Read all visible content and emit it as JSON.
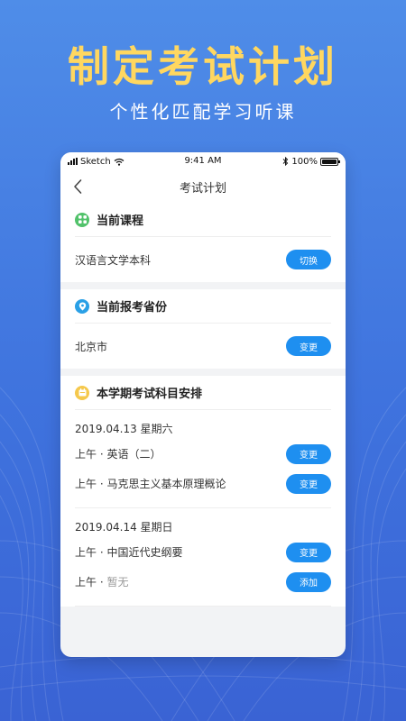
{
  "hero": {
    "title": "制定考试计划",
    "subtitle": "个性化匹配学习听课"
  },
  "status_bar": {
    "carrier": "Sketch",
    "time": "9:41 AM",
    "battery": "100%",
    "icons": [
      "signal-icon",
      "wifi-icon",
      "bluetooth-icon",
      "battery-icon"
    ]
  },
  "nav": {
    "back_icon": "chevron-left-icon",
    "title": "考试计划"
  },
  "course": {
    "title": "当前课程",
    "name": "汉语言文学本科",
    "button": "切换"
  },
  "province": {
    "title": "当前报考省份",
    "name": "北京市",
    "button": "变更"
  },
  "schedule": {
    "title": "本学期考试科目安排",
    "days": [
      {
        "date": "2019.04.13  星期六",
        "items": [
          {
            "label": "上午 · 英语（二）",
            "button": "变更"
          },
          {
            "label": "上午 · 马克思主义基本原理概论",
            "button": "变更"
          }
        ]
      },
      {
        "date": "2019.04.14  星期日",
        "items": [
          {
            "label": "上午 · 中国近代史纲要",
            "button": "变更"
          },
          {
            "label_prefix": "上午 · ",
            "label_muted": "暂无",
            "button": "添加"
          }
        ]
      }
    ]
  },
  "colors": {
    "accent": "#1e8ff0",
    "title_gold": "#ffd760",
    "icon_green": "#52c26b",
    "icon_blue": "#2aa0e6",
    "icon_yellow": "#f5c84c"
  }
}
